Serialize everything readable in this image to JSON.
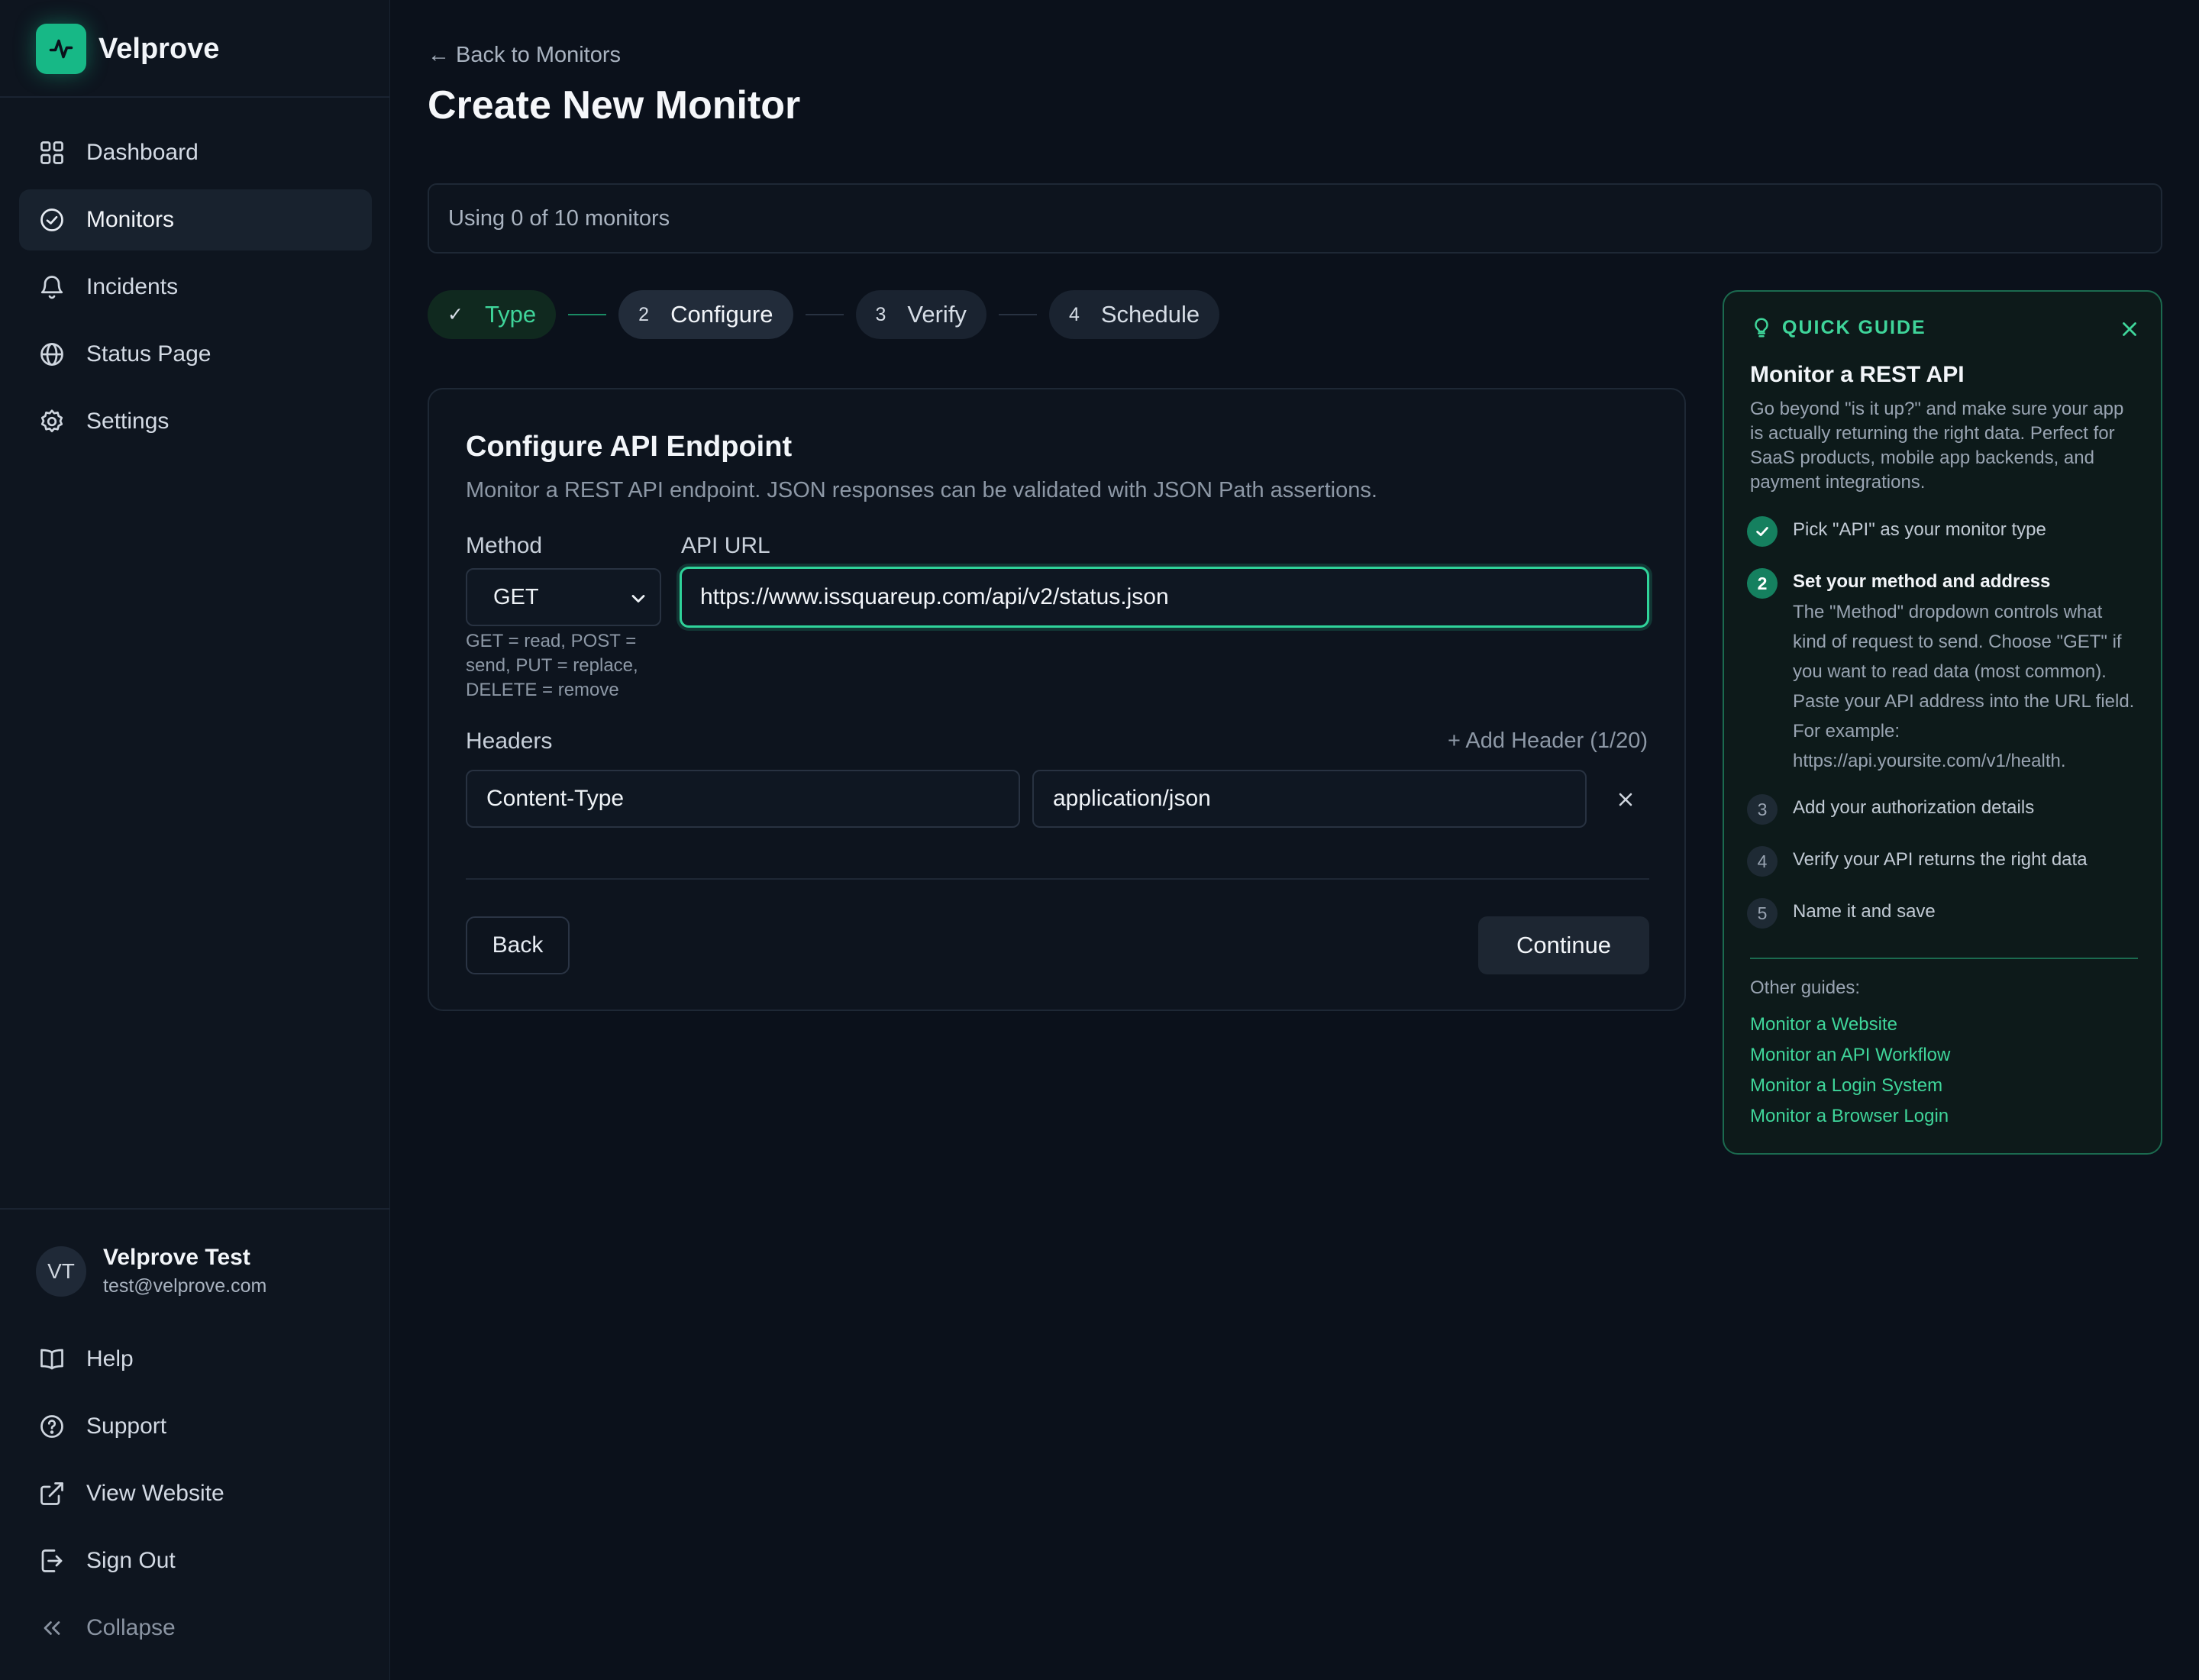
{
  "app": {
    "name": "Velprove"
  },
  "sidebar": {
    "items": [
      {
        "label": "Dashboard",
        "icon": "grid-icon"
      },
      {
        "label": "Monitors",
        "icon": "check-circle-icon",
        "active": true
      },
      {
        "label": "Incidents",
        "icon": "bell-icon"
      },
      {
        "label": "Status Page",
        "icon": "globe-icon"
      },
      {
        "label": "Settings",
        "icon": "gear-icon"
      }
    ],
    "user": {
      "initials": "VT",
      "name": "Velprove Test",
      "email": "test@velprove.com"
    },
    "bottom": [
      {
        "label": "Help",
        "icon": "book-icon"
      },
      {
        "label": "Support",
        "icon": "help-circle-icon"
      },
      {
        "label": "View Website",
        "icon": "external-link-icon"
      },
      {
        "label": "Sign Out",
        "icon": "sign-out-icon"
      },
      {
        "label": "Collapse",
        "icon": "chevrons-left-icon"
      }
    ]
  },
  "header": {
    "back_link": "← Back to Monitors",
    "title": "Create New Monitor",
    "usage": "Using 0 of 10 monitors"
  },
  "stepper": [
    {
      "num": "✓",
      "label": "Type",
      "state": "done"
    },
    {
      "num": "2",
      "label": "Configure",
      "state": "active"
    },
    {
      "num": "3",
      "label": "Verify",
      "state": "pending"
    },
    {
      "num": "4",
      "label": "Schedule",
      "state": "pending"
    }
  ],
  "form": {
    "title": "Configure API Endpoint",
    "description": "Monitor a REST API endpoint. JSON responses can be validated with JSON Path assertions.",
    "method_label": "Method",
    "method_value": "GET",
    "method_hint": "GET = read, POST = send, PUT = replace, DELETE = remove",
    "url_label": "API URL",
    "url_value": "https://www.issquareup.com/api/v2/status.json",
    "headers_label": "Headers",
    "add_header": "+ Add Header (1/20)",
    "header_rows": [
      {
        "key": "Content-Type",
        "value": "application/json"
      }
    ],
    "back_button": "Back",
    "continue_button": "Continue"
  },
  "guide": {
    "tag": "QUICK GUIDE",
    "title": "Monitor a REST API",
    "description": "Go beyond \"is it up?\" and make sure your app is actually returning the right data. Perfect for SaaS products, mobile app backends, and payment integrations.",
    "steps": [
      {
        "badge": "✓",
        "text": "Pick \"API\" as your monitor type",
        "state": "done"
      },
      {
        "badge": "2",
        "text": "Set your method and address",
        "state": "active",
        "detail": "The \"Method\" dropdown controls what kind of request to send. Choose \"GET\" if you want to read data (most common). Paste your API address into the URL field. For example: https://api.yoursite.com/v1/health."
      },
      {
        "badge": "3",
        "text": "Add your authorization details",
        "state": "pending"
      },
      {
        "badge": "4",
        "text": "Verify your API returns the right data",
        "state": "pending"
      },
      {
        "badge": "5",
        "text": "Name it and save",
        "state": "pending"
      }
    ],
    "other_label": "Other guides:",
    "other_links": [
      "Monitor a Website",
      "Monitor an API Workflow",
      "Monitor a Login System",
      "Monitor a Browser Login"
    ]
  },
  "colors": {
    "accent": "#2fd39a",
    "brand": "#17b886",
    "background": "#0b111b"
  }
}
